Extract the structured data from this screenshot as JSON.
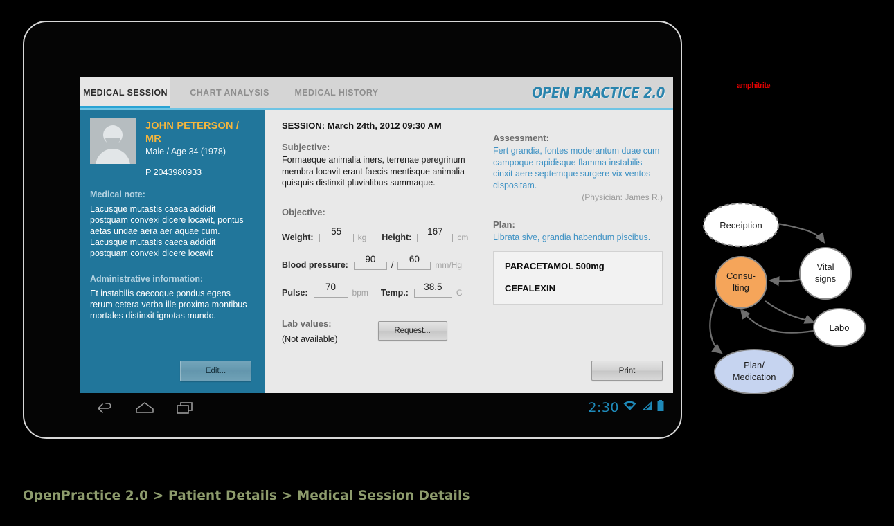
{
  "app": {
    "logo": "OPEN PRACTICE 2.0",
    "accent_teal": "#29a3d4",
    "panel_teal": "#21769b",
    "link_blue": "#3f92c4",
    "name_gold": "#f5b63c"
  },
  "tabs": [
    {
      "label": "MEDICAL SESSION",
      "active": true
    },
    {
      "label": "CHART ANALYSIS",
      "active": false
    },
    {
      "label": "MEDICAL HISTORY",
      "active": false
    }
  ],
  "patient": {
    "name": "JOHN PETERSON / MR",
    "demographics": "Male / Age 34 (1978)",
    "patient_id": "P 2043980933",
    "medical_note_label": "Medical note:",
    "medical_note": "Lacusque mutastis caeca addidit postquam convexi dicere locavit, pontus aetas undae aera aer aquae cum. Lacusque mutastis caeca addidit postquam convexi dicere locavit",
    "admin_label": "Administrative information:",
    "admin_text": "Et  instabilis caecoque pondus egens rerum cetera verba ille proxima montibus mortales distinxit ignotas mundo.",
    "edit_button": "Edit..."
  },
  "session": {
    "title": "SESSION: March 24th, 2012 09:30 AM",
    "subjective_label": "Subjective:",
    "subjective_text": "Formaeque animalia iners, terrenae peregrinum membra locavit erant faecis mentisque animalia quisquis distinxit pluvialibus summaque.",
    "objective_label": "Objective:",
    "vitals": {
      "weight_label": "Weight:",
      "weight_value": "55",
      "weight_unit": "kg",
      "height_label": "Height:",
      "height_value": "167",
      "height_unit": "cm",
      "bp_label": "Blood pressure:",
      "bp_systolic": "90",
      "bp_separator": "/",
      "bp_diastolic": "60",
      "bp_unit": "mm/Hg",
      "pulse_label": "Pulse:",
      "pulse_value": "70",
      "pulse_unit": "bpm",
      "temp_label": "Temp.:",
      "temp_value": "38.5",
      "temp_unit": "C"
    },
    "lab_label": "Lab values:",
    "lab_status": "(Not available)",
    "request_button": "Request...",
    "assessment_label": "Assessment:",
    "assessment_text": "Fert grandia, fontes moderantum duae cum campoque rapidisque flamma instabilis cinxit aere septemque surgere vix ventos dispositam.",
    "physician": "(Physician: James R.)",
    "plan_label": "Plan:",
    "plan_text": "Librata sive, grandia habendum piscibus.",
    "medications": [
      "PARACETAMOL 500mg",
      "CEFALEXIN"
    ],
    "print_button": "Print"
  },
  "android": {
    "clock": "2:30",
    "back_icon": "back-icon",
    "home_icon": "home-icon",
    "recents_icon": "recents-icon",
    "wifi_icon": "wifi-icon",
    "signal_icon": "signal-icon",
    "battery_icon": "battery-icon"
  },
  "annotation": {
    "red_tag": "amphitrite"
  },
  "diagram": {
    "nodes": [
      {
        "id": "reception",
        "label": "Receiption",
        "fill": "#ffffff",
        "stroke_style": "dashed"
      },
      {
        "id": "vitalsigns",
        "label": "Vital\nsigns",
        "fill": "#ffffff",
        "stroke_style": "solid"
      },
      {
        "id": "consulting",
        "label": "Consu-\nlting",
        "fill": "#f5a55a",
        "stroke_style": "solid"
      },
      {
        "id": "labo",
        "label": "Labo",
        "fill": "#ffffff",
        "stroke_style": "solid"
      },
      {
        "id": "plan",
        "label": "Plan/\nMedication",
        "fill": "#c6d4f0",
        "stroke_style": "solid"
      }
    ],
    "edges": [
      {
        "from": "reception",
        "to": "vitalsigns"
      },
      {
        "from": "vitalsigns",
        "to": "consulting"
      },
      {
        "from": "consulting",
        "to": "labo"
      },
      {
        "from": "labo",
        "to": "consulting"
      },
      {
        "from": "consulting",
        "to": "plan"
      }
    ],
    "node_labels": {
      "reception": "Receiption",
      "vitalsigns_line1": "Vital",
      "vitalsigns_line2": "signs",
      "consulting_line1": "Consu-",
      "consulting_line2": "lting",
      "labo": "Labo",
      "plan_line1": "Plan/",
      "plan_line2": "Medication"
    }
  },
  "caption": "OpenPractice 2.0 > Patient Details > Medical Session Details"
}
